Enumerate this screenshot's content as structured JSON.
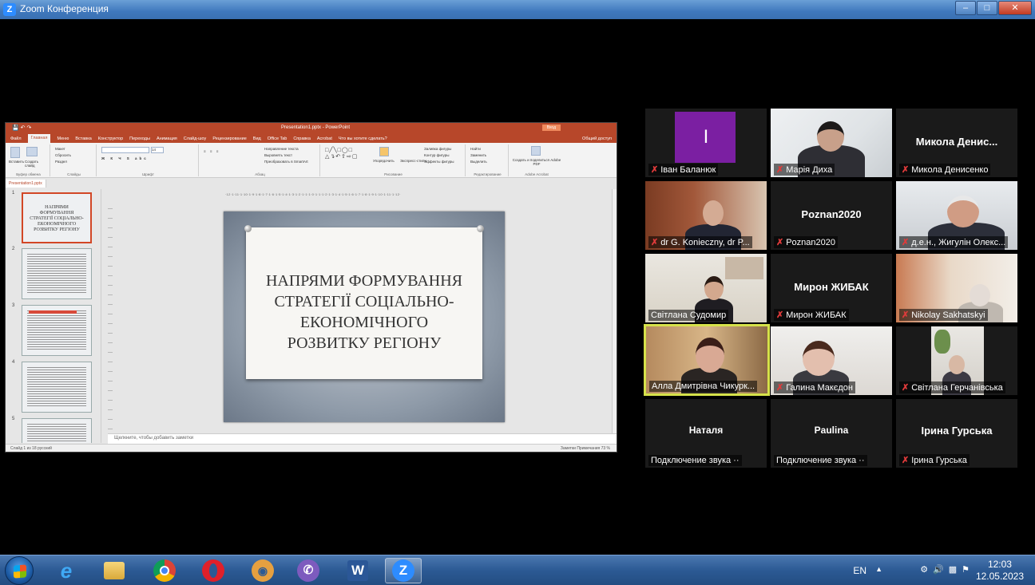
{
  "window": {
    "title": "Zoom Конференция",
    "app_icon": "zoom-icon",
    "controls": [
      "minimize",
      "maximize",
      "close"
    ]
  },
  "shared_screen": {
    "app": "PowerPoint",
    "titlebar": {
      "document": "Presentation1.pptx - PowerPoint",
      "signin": "Вход"
    },
    "tabs": [
      "Файл",
      "Главная",
      "Меню",
      "Вставка",
      "Конструктор",
      "Переходы",
      "Анимация",
      "Слайд-шоу",
      "Рецензирование",
      "Вид",
      "Office Tab",
      "Справка",
      "Acrobat",
      "Что вы хотите сделать?"
    ],
    "active_tab": "Главная",
    "share_link": "Общий доступ",
    "ribbon_groups": [
      "Буфер обмена",
      "Слайды",
      "Шрифт",
      "Абзац",
      "Рисование",
      "Редактирование",
      "Adobe Acrobat"
    ],
    "ribbon_buttons": {
      "paste": "Вставить",
      "new_slide": "Создать слайд",
      "layout": "Макет",
      "reset": "Сбросить",
      "section": "Раздел",
      "text_direction": "Направление текста",
      "align_text": "Выровнять текст",
      "smartart": "Преобразовать в SmartArt",
      "arrange": "Упорядочить",
      "quick_styles": "Экспресс-стили",
      "shape_fill": "Заливка фигуры",
      "shape_outline": "Контур фигуры",
      "shape_effects": "Эффекты фигуры",
      "find": "Найти",
      "replace": "Заменить",
      "select": "Выделить",
      "create_pdf": "Создать и поделиться Adobe PDF",
      "font_size": "14"
    },
    "file_tab": "Presentation1.pptx",
    "thumbnail_numbers": [
      "1",
      "2",
      "3",
      "4",
      "5"
    ],
    "thumbnail1_text": "НАПРЯМИ ФОРМУВАННЯ СТРАТЕГІЇ СОЦІАЛЬНО-ЕКОНОМІЧНОГО РОЗВИТКУ РЕГІОНУ",
    "ruler": "·12·1·11·1·10·1·9·1·8·1·7·1·6·1·5·1·4·1·3·1·2·1·1·1·0·1·1·1·2·1·3·1·4·1·5·1·6·1·7·1·8·1·9·1·10·1·11·1·12·",
    "slide_title": "НАПРЯМИ ФОРМУВАННЯ\nСТРАТЕГІЇ СОЦІАЛЬНО-\nЕКОНОМІЧНОГО\nРОЗВИТКУ РЕГІОНУ",
    "notes_placeholder": "Щелкните, чтобы добавить заметки",
    "status_left": "Слайд 1 из 18    русский",
    "status_right": "Заметки   Примечания          73 %"
  },
  "participants": [
    {
      "name": "Іван Баланюк",
      "center": "I",
      "muted": true,
      "video": false,
      "avatar_color": "#7b1fa2"
    },
    {
      "name": "Марія Диха",
      "center": "",
      "muted": true,
      "video": true
    },
    {
      "name": "Микола Денисенко",
      "center": "Микола  Денис...",
      "muted": true,
      "video": false
    },
    {
      "name": "dr G. Konieczny, dr P...",
      "center": "",
      "muted": true,
      "video": true
    },
    {
      "name": "Poznan2020",
      "center": "Poznan2020",
      "muted": true,
      "video": false
    },
    {
      "name": "д.е.н., Жигулін Олекс...",
      "center": "",
      "muted": true,
      "video": true
    },
    {
      "name": "Світлана Судомир",
      "center": "",
      "muted": false,
      "video": true
    },
    {
      "name": "Мирон ЖИБАК",
      "center": "Мирон ЖИБАК",
      "muted": true,
      "video": false
    },
    {
      "name": "Nikolay Sakhatskyi",
      "center": "",
      "muted": true,
      "video": true
    },
    {
      "name": "Алла Дмитрівна Чикурк...",
      "center": "",
      "muted": false,
      "video": true,
      "active_speaker": true
    },
    {
      "name": "Галина Макєдон",
      "center": "",
      "muted": true,
      "video": true
    },
    {
      "name": "Світлана Герчанівська",
      "center": "",
      "muted": true,
      "video": true
    },
    {
      "name": "Подключение звука ··",
      "center": "Наталя",
      "muted": false,
      "video": false
    },
    {
      "name": "Подключение звука ··",
      "center": "Paulina",
      "muted": false,
      "video": false
    },
    {
      "name": "Ірина Гурська",
      "center": "Ірина Гурська",
      "muted": true,
      "video": false
    }
  ],
  "taskbar": {
    "start": "start-button",
    "items": [
      "ie-icon",
      "explorer-icon",
      "chrome-icon",
      "opera-icon",
      "screenshot-tool-icon",
      "viber-icon",
      "word-icon",
      "zoom-icon"
    ],
    "active_item": "zoom-icon",
    "language": "EN",
    "time": "12:03",
    "date": "12.05.2023"
  },
  "colors": {
    "zoom_blue": "#2d8cff",
    "muted_red": "#e03b3b",
    "active_speaker": "#d6e24a",
    "powerpoint_red": "#b7472a"
  }
}
